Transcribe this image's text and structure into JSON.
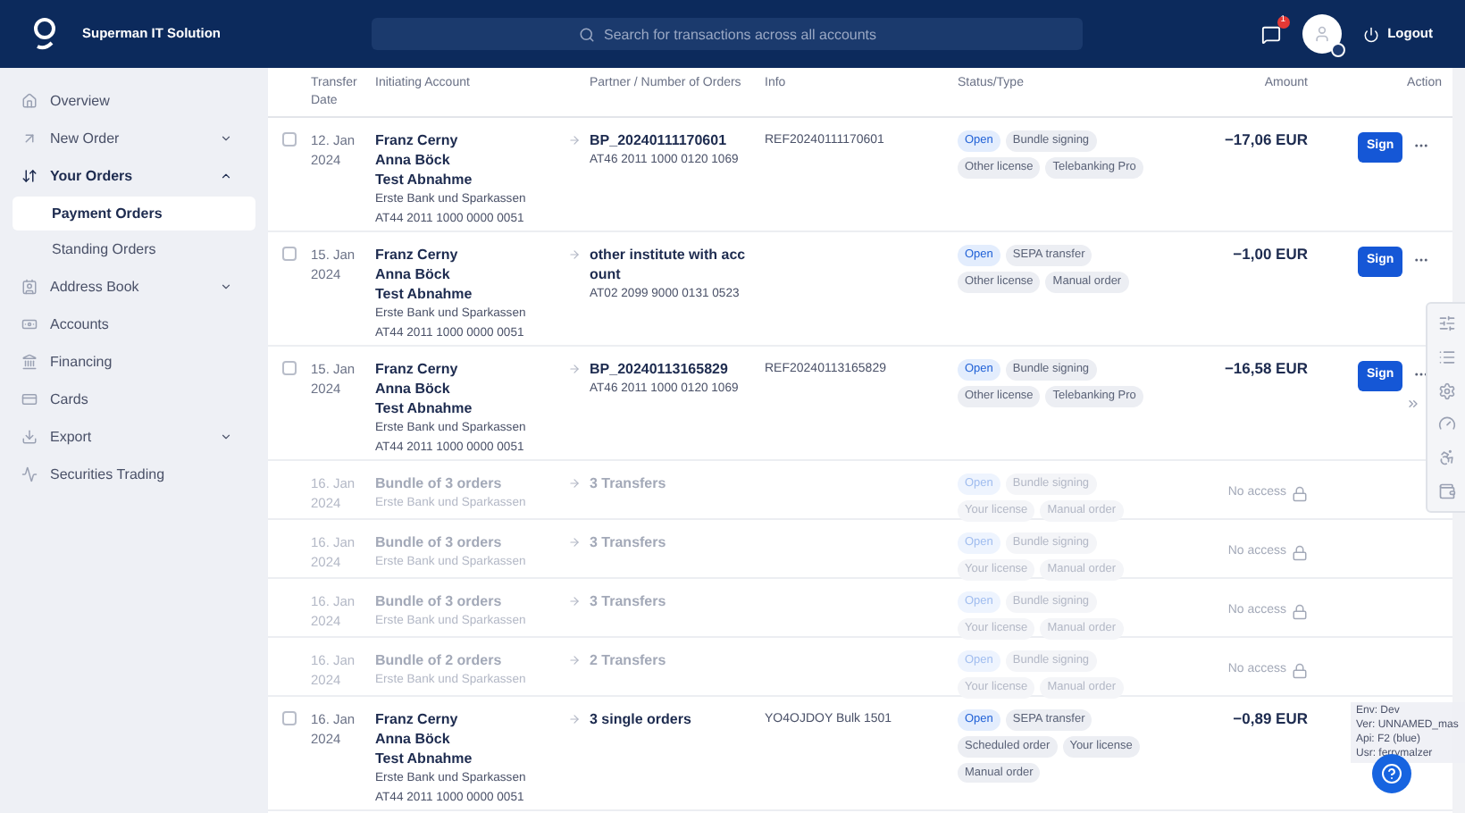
{
  "header": {
    "brand": "Superman IT Solution",
    "search": {
      "placeholder": "Search for transactions across all accounts"
    },
    "notifications": "1",
    "logout": "Logout"
  },
  "sidebar": {
    "items": [
      {
        "label": "Overview",
        "selected": false
      },
      {
        "label": "New Order",
        "selected": false,
        "expanded": false
      },
      {
        "label": "Your Orders",
        "selected": true,
        "expanded": true,
        "children": [
          {
            "label": "Payment Orders",
            "selected": true
          },
          {
            "label": "Standing Orders",
            "selected": false
          }
        ]
      },
      {
        "label": "Address Book",
        "selected": false,
        "expanded": false
      },
      {
        "label": "Accounts",
        "selected": false
      },
      {
        "label": "Financing",
        "selected": false
      },
      {
        "label": "Cards",
        "selected": false
      },
      {
        "label": "Export",
        "selected": false,
        "expanded": false
      },
      {
        "label": "Securities Trading",
        "selected": false
      }
    ]
  },
  "table": {
    "columns": [
      "Transfer Date",
      "Initiating Account",
      "Partner / Number of Orders",
      "Info",
      "Status/Type",
      "Amount",
      "Action"
    ],
    "rows": [
      {
        "kind": "order",
        "checked": false,
        "date": [
          "12. Jan",
          "2024"
        ],
        "names": [
          "Franz Cerny",
          "Anna Böck",
          "Test Abnahme"
        ],
        "bank": "Erste Bank und Sparkassen",
        "iban": "AT44 2011 1000 0000 0051",
        "partner": "BP_20240111170601",
        "partner_iban": "AT46 2011 1000 0120 1069",
        "info": "REF20240111170601",
        "tags": [
          {
            "label": "Open",
            "kind": "status"
          },
          {
            "label": "Bundle signing",
            "kind": "type"
          },
          {
            "label": "Other license",
            "kind": "type"
          },
          {
            "label": "Telebanking Pro",
            "kind": "type"
          }
        ],
        "amount": "−17,06 EUR",
        "action": "Sign"
      },
      {
        "kind": "order",
        "checked": false,
        "date": [
          "15. Jan",
          "2024"
        ],
        "names": [
          "Franz Cerny",
          "Anna Böck",
          "Test Abnahme"
        ],
        "bank": "Erste Bank und Sparkassen",
        "iban": "AT44 2011 1000 0000 0051",
        "partner": "other institute with acc ount",
        "partner_iban": "AT02 2099 9000 0131 0523",
        "tags": [
          {
            "label": "Open",
            "kind": "status"
          },
          {
            "label": "SEPA transfer",
            "kind": "type"
          },
          {
            "label": "Other license",
            "kind": "type"
          },
          {
            "label": "Manual order",
            "kind": "type"
          }
        ],
        "amount": "−1,00 EUR",
        "action": "Sign"
      },
      {
        "kind": "order",
        "checked": false,
        "date": [
          "15. Jan",
          "2024"
        ],
        "names": [
          "Franz Cerny",
          "Anna Böck",
          "Test Abnahme"
        ],
        "bank": "Erste Bank und Sparkassen",
        "iban": "AT44 2011 1000 0000 0051",
        "partner": "BP_20240113165829",
        "partner_iban": "AT46 2011 1000 0120 1069",
        "info": "REF20240113165829",
        "tags": [
          {
            "label": "Open",
            "kind": "status"
          },
          {
            "label": "Bundle signing",
            "kind": "type"
          },
          {
            "label": "Other license",
            "kind": "type"
          },
          {
            "label": "Telebanking Pro",
            "kind": "type"
          }
        ],
        "amount": "−16,58 EUR",
        "action": "Sign"
      },
      {
        "kind": "bundle",
        "date": [
          "16. Jan",
          "2024"
        ],
        "names": [
          "Bundle of 3 orders"
        ],
        "bank": "Erste Bank und Sparkassen",
        "partner": "3 Transfers",
        "tags": [
          {
            "label": "Open",
            "kind": "status"
          },
          {
            "label": "Bundle signing",
            "kind": "type"
          },
          {
            "label": "Your license",
            "kind": "type"
          },
          {
            "label": "Manual order",
            "kind": "type"
          }
        ],
        "amount": "No access"
      },
      {
        "kind": "bundle",
        "date": [
          "16. Jan",
          "2024"
        ],
        "names": [
          "Bundle of 3 orders"
        ],
        "bank": "Erste Bank und Sparkassen",
        "partner": "3 Transfers",
        "tags": [
          {
            "label": "Open",
            "kind": "status"
          },
          {
            "label": "Bundle signing",
            "kind": "type"
          },
          {
            "label": "Your license",
            "kind": "type"
          },
          {
            "label": "Manual order",
            "kind": "type"
          }
        ],
        "amount": "No access"
      },
      {
        "kind": "bundle",
        "date": [
          "16. Jan",
          "2024"
        ],
        "names": [
          "Bundle of 3 orders"
        ],
        "bank": "Erste Bank und Sparkassen",
        "partner": "3 Transfers",
        "tags": [
          {
            "label": "Open",
            "kind": "status"
          },
          {
            "label": "Bundle signing",
            "kind": "type"
          },
          {
            "label": "Your license",
            "kind": "type"
          },
          {
            "label": "Manual order",
            "kind": "type"
          }
        ],
        "amount": "No access"
      },
      {
        "kind": "bundle",
        "date": [
          "16. Jan",
          "2024"
        ],
        "names": [
          "Bundle of 2 orders"
        ],
        "bank": "Erste Bank und Sparkassen",
        "partner": "2 Transfers",
        "tags": [
          {
            "label": "Open",
            "kind": "status"
          },
          {
            "label": "Bundle signing",
            "kind": "type"
          },
          {
            "label": "Your license",
            "kind": "type"
          },
          {
            "label": "Manual order",
            "kind": "type"
          }
        ],
        "amount": "No access"
      },
      {
        "kind": "order",
        "checked": false,
        "date": [
          "16. Jan",
          "2024"
        ],
        "names": [
          "Franz Cerny",
          "Anna Böck",
          "Test Abnahme"
        ],
        "bank": "Erste Bank und Sparkassen",
        "iban": "AT44 2011 1000 0000 0051",
        "partner": "3 single orders",
        "info": "YO4OJDOY Bulk 1501",
        "tags": [
          {
            "label": "Open",
            "kind": "status"
          },
          {
            "label": "SEPA transfer",
            "kind": "type"
          },
          {
            "label": "Scheduled order",
            "kind": "type"
          },
          {
            "label": "Your license",
            "kind": "type"
          },
          {
            "label": "Manual order",
            "kind": "type"
          }
        ],
        "amount": "−0,89 EUR"
      }
    ]
  },
  "env_info": [
    "Env: Dev",
    "Ver: UNNAMED_mas",
    "Api: F2 (blue)",
    "Usr: ferrymalzer"
  ]
}
